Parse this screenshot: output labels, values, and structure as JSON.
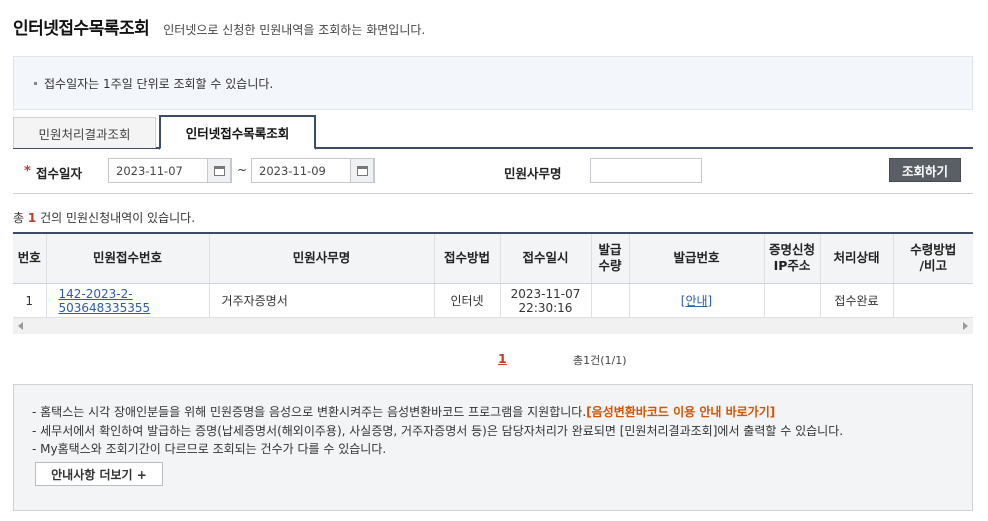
{
  "header": {
    "title": "인터넷접수목록조회",
    "description": "인터넷으로 신청한 민원내역을 조회하는 화면입니다."
  },
  "notice": "접수일자는 1주일 단위로 조회할 수 있습니다.",
  "tabs": [
    {
      "label": "민원처리결과조회",
      "active": false
    },
    {
      "label": "인터넷접수목록조회",
      "active": true
    }
  ],
  "search": {
    "required_mark": "*",
    "date_label": "접수일자",
    "date_from": "2023-11-07",
    "date_to": "2023-11-09",
    "range_sep": "~",
    "office_label": "민원사무명",
    "office_value": "",
    "button_label": "조회하기"
  },
  "summary": {
    "prefix": "총",
    "count": "1",
    "suffix": "건의 민원신청내역이 있습니다."
  },
  "table": {
    "headers": [
      "번호",
      "민원접수번호",
      "민원사무명",
      "접수방법",
      "접수일시",
      "발급\n수량",
      "발급번호",
      "증명신청\nIP주소",
      "처리상태",
      "수령방법\n/비고"
    ],
    "rows": [
      {
        "no": "1",
        "receipt_no": "142-2023-2-503648335355",
        "office": "거주자증명서",
        "method": "인터넷",
        "date": "2023-11-07",
        "time": "22:30:16",
        "qty": "",
        "issue_no": "[안내]",
        "ip": "",
        "status": "접수완료",
        "note": ""
      }
    ]
  },
  "pagination": {
    "current": "1",
    "total": "총1건(1/1)"
  },
  "info": {
    "lines": [
      "- 홈택스는 시각 장애인분들을 위해 민원증명을 음성으로 변환시켜주는 음성변환바코드 프로그램을 지원합니다.",
      "- 세무서에서 확인하여 발급하는 증명(납세증명서(해외이주용), 사실증명, 거주자증명서 등)은 담당자처리가 완료되면 [민원처리결과조회]에서 출력할 수 있습니다.",
      "- My홈택스와 조회기간이 다르므로 조회되는 건수가 다를 수 있습니다."
    ],
    "link_text": "[음성변환바코드 이용 안내 바로가기]",
    "more_button": "안내사항 더보기 +"
  },
  "colors": {
    "accent_red": "#c0392b",
    "link_blue": "#2a5da8",
    "highlight_orange": "#d35400",
    "tab_border": "#3c4d63"
  }
}
